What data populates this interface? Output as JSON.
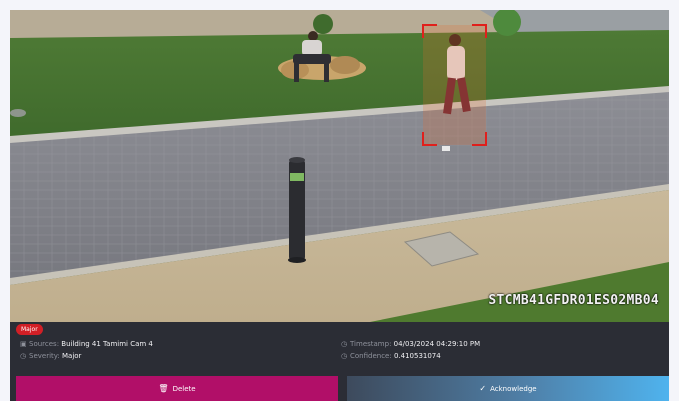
{
  "camera": {
    "overlay_id": "STCMB41GFDR01ES02MB04"
  },
  "alert": {
    "severity_badge": "Major",
    "sources_label": "Sources:",
    "sources_value": "Building 41 Tamimi Cam 4",
    "severity_label": "Severity:",
    "severity_value": "Major",
    "timestamp_label": "Timestamp:",
    "timestamp_value": "04/03/2024 04:29:10 PM",
    "confidence_label": "Confidence:",
    "confidence_value": "0.410531074"
  },
  "actions": {
    "delete_label": "Delete",
    "acknowledge_label": "Acknowledge"
  },
  "icons": {
    "sources": "camera-icon",
    "severity": "clock-icon",
    "timestamp": "clock-icon",
    "confidence": "clock-icon",
    "delete": "trash-icon",
    "acknowledge": "check-icon"
  },
  "colors": {
    "badge": "#d21f26",
    "delete_button": "#b10f68",
    "acknowledge_gradient_end": "#4fb3ee",
    "detection_box": "#e0201c"
  }
}
